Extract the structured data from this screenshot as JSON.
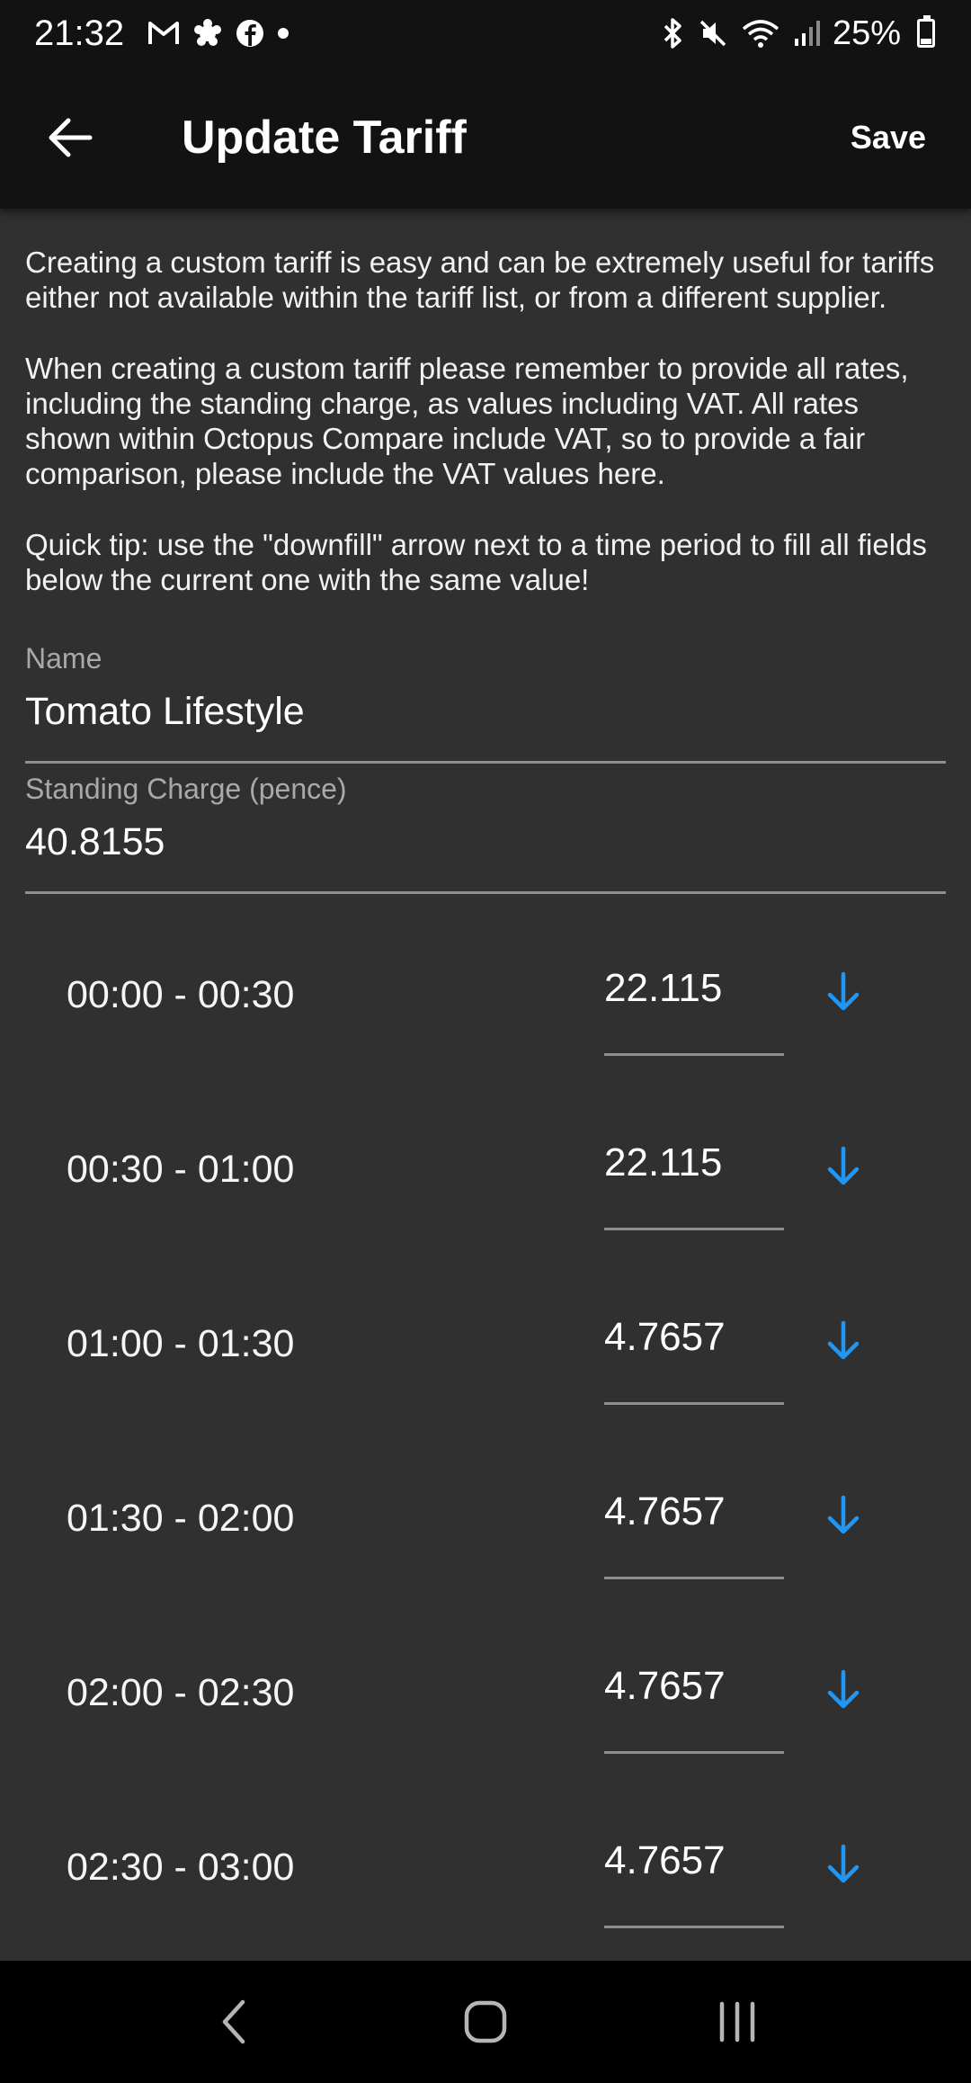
{
  "status_bar": {
    "time": "21:32",
    "notification_icons": [
      "gmail-icon",
      "settings-flower-icon",
      "facebook-icon",
      "dot-icon"
    ],
    "battery_percent": "25%",
    "battery_level": 0.25
  },
  "app_bar": {
    "title": "Update Tariff",
    "save_label": "Save"
  },
  "intro": {
    "paragraphs": [
      "Creating a custom tariff is easy and can be extremely useful for tariffs either not available within the tariff list, or from a different supplier.",
      "When creating a custom tariff please remember to provide all rates, including the standing charge, as values including VAT. All rates shown within Octopus Compare include VAT, so to provide a fair comparison, please include the VAT values here.",
      "Quick tip: use the \"downfill\" arrow next to a time period to fill all fields below the current one with the same value!"
    ]
  },
  "form": {
    "name": {
      "label": "Name",
      "value": "Tomato Lifestyle"
    },
    "standing_charge": {
      "label": "Standing Charge (pence)",
      "value": "40.8155"
    }
  },
  "rates": [
    {
      "time": "00:00 - 00:30",
      "value": "22.115"
    },
    {
      "time": "00:30 - 01:00",
      "value": "22.115"
    },
    {
      "time": "01:00 - 01:30",
      "value": "4.7657"
    },
    {
      "time": "01:30 - 02:00",
      "value": "4.7657"
    },
    {
      "time": "02:00 - 02:30",
      "value": "4.7657"
    },
    {
      "time": "02:30 - 03:00",
      "value": "4.7657"
    }
  ],
  "colors": {
    "background": "#303030",
    "app_bar": "#121212",
    "accent_arrow": "#2196F3",
    "divider": "#8e8e8e"
  }
}
